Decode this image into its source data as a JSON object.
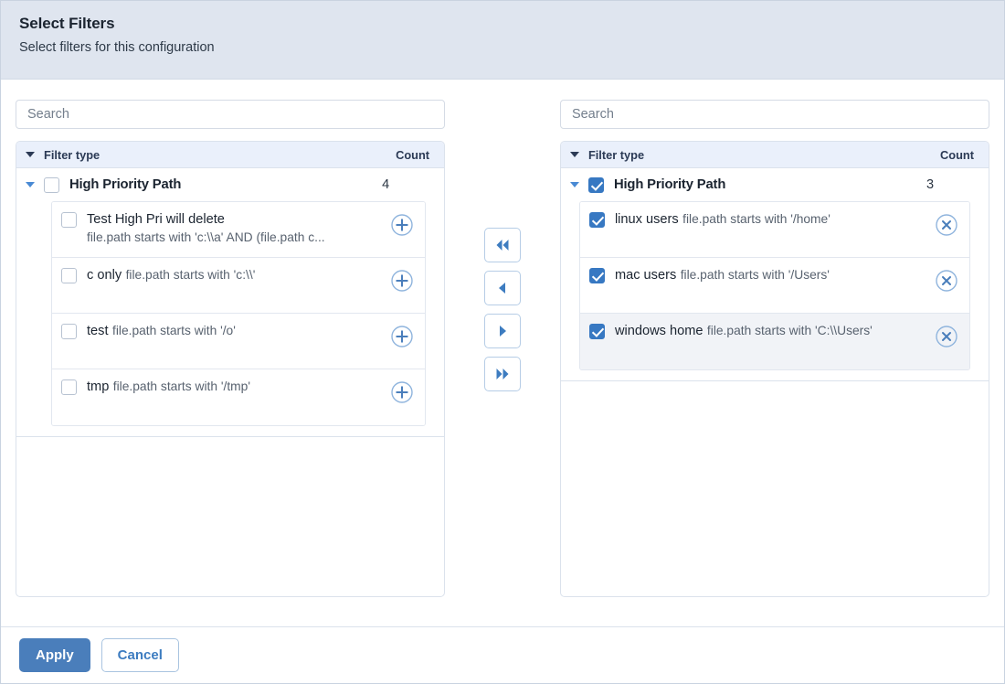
{
  "header": {
    "title": "Select Filters",
    "subtitle": "Select filters for this configuration"
  },
  "columns": {
    "filter_type": "Filter type",
    "count": "Count"
  },
  "left_panel": {
    "search_placeholder": "Search",
    "search_value": "",
    "group": {
      "label": "High Priority Path",
      "count": "4",
      "checked": false,
      "expanded": true
    },
    "items": [
      {
        "name": "Test High Pri will delete",
        "description": "file.path starts with 'c:\\\\a' AND (file.path c...",
        "checked": false,
        "action_icon": "circle-plus-icon"
      },
      {
        "name": "c only",
        "description": "file.path starts with 'c:\\\\'",
        "checked": false,
        "action_icon": "circle-plus-icon"
      },
      {
        "name": "test",
        "description": "file.path starts with '/o'",
        "checked": false,
        "action_icon": "circle-plus-icon"
      },
      {
        "name": "tmp",
        "description": "file.path starts with '/tmp'",
        "checked": false,
        "action_icon": "circle-plus-icon"
      }
    ]
  },
  "right_panel": {
    "search_placeholder": "Search",
    "search_value": "",
    "group": {
      "label": "High Priority Path",
      "count": "3",
      "checked": true,
      "expanded": true
    },
    "items": [
      {
        "name": "linux users",
        "description": "file.path starts with '/home'",
        "checked": true,
        "action_icon": "circle-x-icon",
        "focused": false
      },
      {
        "name": "mac users",
        "description": "file.path starts with '/Users'",
        "checked": true,
        "action_icon": "circle-x-icon",
        "focused": false
      },
      {
        "name": "windows home",
        "description": "file.path starts with 'C:\\\\Users'",
        "checked": true,
        "action_icon": "circle-x-icon",
        "focused": true
      }
    ]
  },
  "transfer_buttons": [
    {
      "name": "move-all-left-button",
      "icon": "double-chevron-left-icon"
    },
    {
      "name": "move-left-button",
      "icon": "chevron-left-icon"
    },
    {
      "name": "move-right-button",
      "icon": "chevron-right-icon"
    },
    {
      "name": "move-all-right-button",
      "icon": "double-chevron-right-icon"
    }
  ],
  "footer": {
    "apply_label": "Apply",
    "cancel_label": "Cancel"
  },
  "colors": {
    "header_bg": "#dfe5ef",
    "table_header_bg": "#eaf0fb",
    "accent_blue": "#3778c2",
    "primary_button_bg": "#4a7ebb",
    "icon_blue": "#4a8ad4"
  }
}
